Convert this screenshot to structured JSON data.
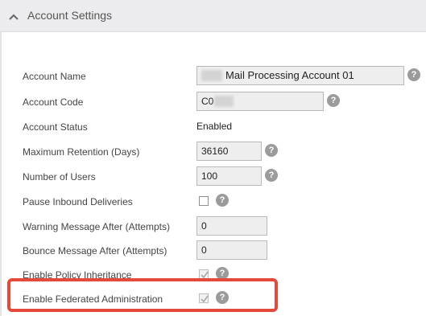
{
  "panel": {
    "title": "Account Settings",
    "collapse_icon": "chevron-up-icon"
  },
  "fields": {
    "account_name": {
      "label": "Account Name",
      "value": "Mail Processing Account 01"
    },
    "account_code": {
      "label": "Account Code",
      "value": "C0"
    },
    "account_status": {
      "label": "Account Status",
      "value": "Enabled"
    },
    "max_retention": {
      "label": "Maximum Retention (Days)",
      "value": "36160"
    },
    "num_users": {
      "label": "Number of Users",
      "value": "100"
    },
    "pause_inbound": {
      "label": "Pause Inbound Deliveries",
      "checked": false
    },
    "warning_after": {
      "label": "Warning Message After (Attempts)",
      "value": "0"
    },
    "bounce_after": {
      "label": "Bounce Message After (Attempts)",
      "value": "0"
    },
    "policy_inheritance": {
      "label": "Enable Policy Inheritance",
      "checked": true,
      "disabled": true
    },
    "federated_admin": {
      "label": "Enable Federated Administration",
      "checked": true,
      "disabled": true
    }
  },
  "help": {
    "glyph": "?",
    "icon": "help-icon"
  },
  "colors": {
    "highlight": "#e34a3b",
    "help_icon": "#9b9b9b",
    "input_bg": "#eeeeee",
    "header_bg": "#ececee"
  }
}
